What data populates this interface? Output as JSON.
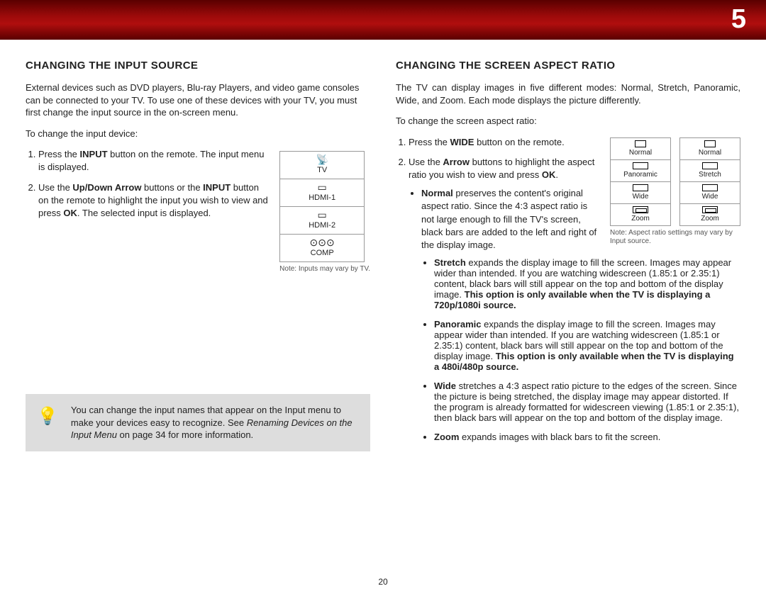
{
  "chapter": "5",
  "page_number": "20",
  "left": {
    "heading": "CHANGING THE INPUT SOURCE",
    "intro": "External devices such as DVD players, Blu-ray Players, and video game consoles can be connected to your TV. To use one of these devices with your TV, you must first change the input source in the on-screen menu.",
    "lead_in": "To change the input device:",
    "step1_a": "Press the ",
    "step1_b": "INPUT",
    "step1_c": " button on the remote. The input menu is displayed.",
    "step2_a": "Use the ",
    "step2_b": "Up/Down Arrow",
    "step2_c": " buttons or the ",
    "step2_d": "INPUT",
    "step2_e": " button on the remote to highlight the input you wish to view and press ",
    "step2_f": "OK",
    "step2_g": ". The selected input is displayed.",
    "menu": {
      "tv": "TV",
      "hdmi1": "HDMI-1",
      "hdmi2": "HDMI-2",
      "comp": "COMP"
    },
    "menu_note": "Note: Inputs may vary by TV.",
    "tip_a": "You can change the input names that appear on the Input menu to make your devices easy to recognize. See ",
    "tip_b": "Renaming Devices on the Input Menu",
    "tip_c": " on page 34 for more information."
  },
  "right": {
    "heading": "CHANGING THE SCREEN ASPECT RATIO",
    "intro": "The TV can display images in five different modes: Normal, Stretch, Panoramic, Wide, and Zoom. Each mode displays the picture differently.",
    "lead_in": "To change the screen aspect ratio:",
    "step1_a": "Press the ",
    "step1_b": "WIDE",
    "step1_c": " button on the remote.",
    "step2_a": "Use the ",
    "step2_b": "Arrow",
    "step2_c": " buttons to highlight the aspect ratio you wish to view and press ",
    "step2_d": "OK",
    "step2_e": ".",
    "normal_a": "Normal",
    "normal_b": " preserves the content's original aspect ratio. Since the 4:3 aspect ratio is not large enough to fill the TV's screen, black bars are added to the left and right of the display image.",
    "stretch_a": "Stretch",
    "stretch_b": " expands the display image to fill the screen. Images may appear wider than intended. If you are watching widescreen (1.85:1 or 2.35:1) content, black bars will still appear on the top and bottom of the display image. ",
    "stretch_c": "This option is only available when the TV is displaying a 720p/1080i source.",
    "pano_a": "Panoramic",
    "pano_b": " expands the display image to fill the screen. Images may appear wider than intended. If you are watching widescreen (1.85:1 or 2.35:1) content, black bars will still appear on the top and bottom of the display image. ",
    "pano_c": "This option is only available when the TV is displaying a 480i/480p source.",
    "wide_a": "Wide",
    "wide_b": " stretches a 4:3 aspect ratio picture to the edges of the screen. Since the picture is being stretched, the display image may appear distorted. If the program is already formatted for widescreen viewing (1.85:1 or 2.35:1), then black bars will appear on the top and bottom of the display image.",
    "zoom_a": "Zoom",
    "zoom_b": " expands images with black bars to fit the screen.",
    "aspect_labels": {
      "normal": "Normal",
      "panoramic": "Panoramic",
      "stretch": "Stretch",
      "wide": "Wide",
      "zoom": "Zoom"
    },
    "aspect_note": "Note: Aspect ratio settings may vary by Input source."
  }
}
